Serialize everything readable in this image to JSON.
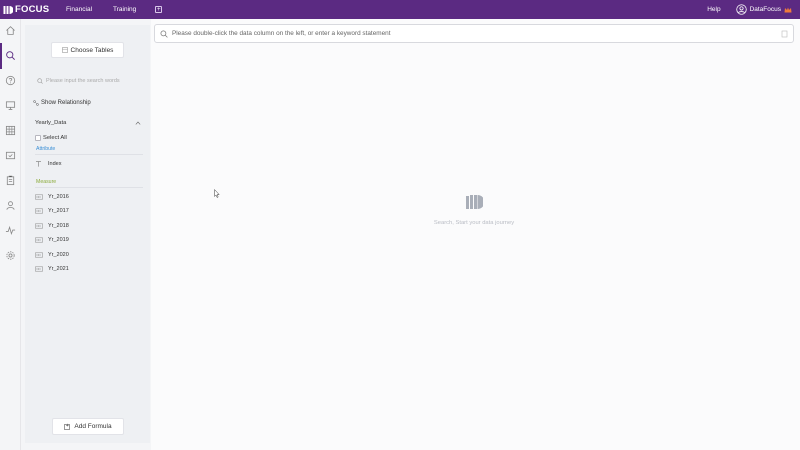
{
  "topbar": {
    "logo_text": "FOCUS",
    "nav": [
      "Financial",
      "Training"
    ],
    "help": "Help",
    "user_name": "DataFocus"
  },
  "rail": {
    "icons": [
      "home-icon",
      "search-icon",
      "question-icon",
      "monitor-icon",
      "grid-icon",
      "inbox-icon",
      "clipboard-icon",
      "user-icon",
      "activity-icon",
      "gear-icon"
    ],
    "active_index": 1
  },
  "panel": {
    "choose_tables": "Choose Tables",
    "search_placeholder": "Please input the search words",
    "show_relationship": "Show Relationship",
    "table_name": "Yearly_Data",
    "select_all": "Select All",
    "attribute_label": "Attribute",
    "attributes": [
      "Index"
    ],
    "measure_label": "Measure",
    "measures": [
      "Yr_2016",
      "Yr_2017",
      "Yr_2018",
      "Yr_2019",
      "Yr_2020",
      "Yr_2021"
    ],
    "add_formula": "Add Formula"
  },
  "main": {
    "search_placeholder": "Please double-click the data column on the left, or enter a keyword statement",
    "empty_text": "Search, Start your data journey"
  },
  "colors": {
    "brand": "#5b2a82",
    "attribute": "#3a8fd6",
    "measure": "#8bab3a"
  }
}
